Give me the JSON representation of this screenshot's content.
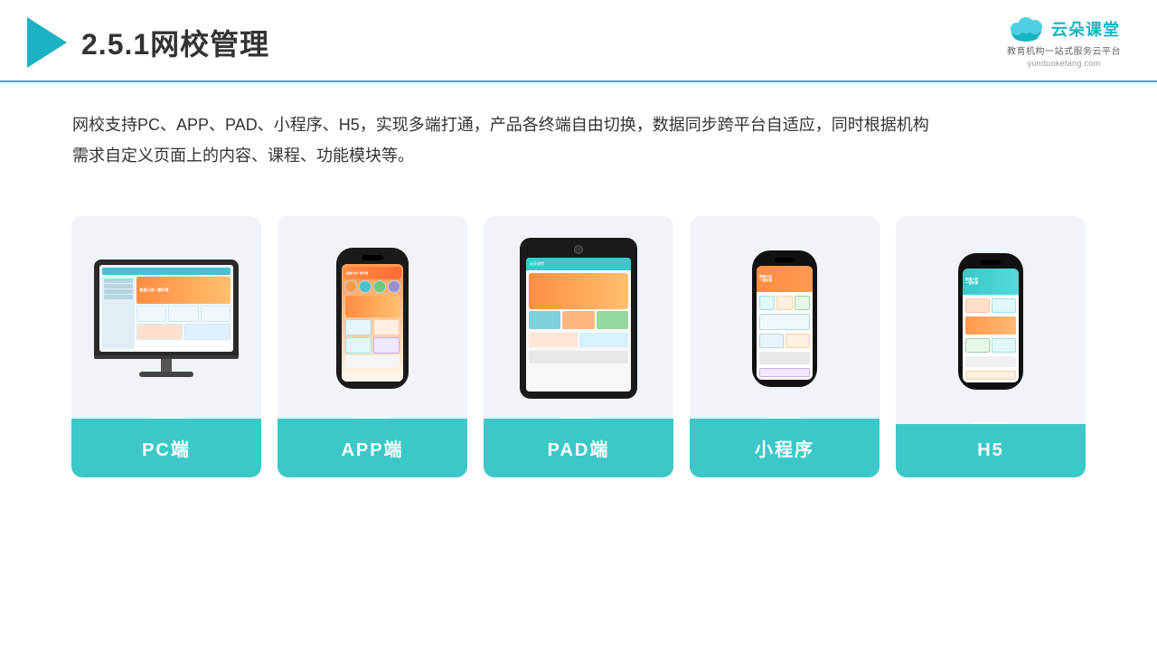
{
  "header": {
    "title": "2.5.1网校管理",
    "logo_main": "云朵课堂",
    "logo_domain": "yunduoketang.com",
    "logo_tagline": "教育机构一站\n式服务云平台"
  },
  "description": {
    "text": "网校支持PC、APP、PAD、小程序、H5，实现多端打通，产品各终端自由切换，数据同步跨平台自适应，同时根据机构需求自定义页面上的内容、课程、功能模块等。"
  },
  "cards": [
    {
      "id": "pc",
      "label": "PC端"
    },
    {
      "id": "app",
      "label": "APP端"
    },
    {
      "id": "pad",
      "label": "PAD端"
    },
    {
      "id": "miniprogram",
      "label": "小程序"
    },
    {
      "id": "h5",
      "label": "H5"
    }
  ],
  "colors": {
    "accent": "#3cc8c8",
    "header_border": "#1ab3c4",
    "play_icon": "#1ab3c4",
    "card_bg": "#f0f4f8",
    "label_bg": "#3cc8c8"
  }
}
